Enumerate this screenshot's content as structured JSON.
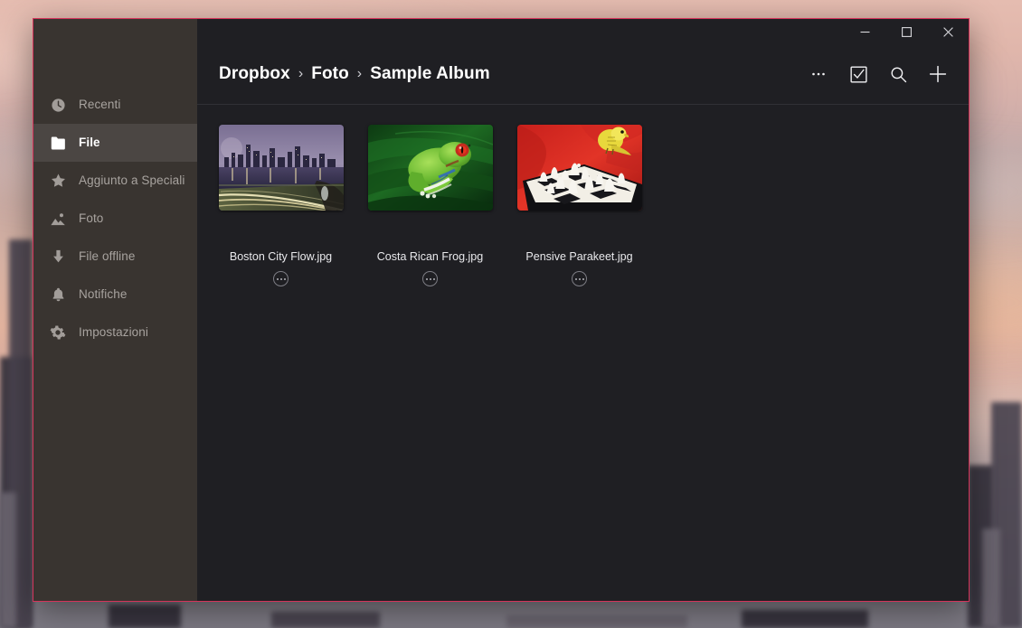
{
  "window": {
    "accent_border_color": "#d4335a",
    "sidebar_bg": "#393430",
    "content_bg": "#1f1f23",
    "controls": {
      "minimize": "minimize",
      "maximize": "maximize",
      "close": "close"
    }
  },
  "sidebar": {
    "items": [
      {
        "label": "Recenti",
        "icon": "clock-icon",
        "selected": false
      },
      {
        "label": "File",
        "icon": "folder-icon",
        "selected": true
      },
      {
        "label": "Aggiunto a Speciali",
        "icon": "star-icon",
        "selected": false
      },
      {
        "label": "Foto",
        "icon": "photo-icon",
        "selected": false
      },
      {
        "label": "File offline",
        "icon": "download-arrow-icon",
        "selected": false
      },
      {
        "label": "Notifiche",
        "icon": "bell-icon",
        "selected": false
      },
      {
        "label": "Impostazioni",
        "icon": "gear-icon",
        "selected": false
      }
    ]
  },
  "header": {
    "breadcrumb": [
      {
        "label": "Dropbox"
      },
      {
        "label": "Foto"
      },
      {
        "label": "Sample Album"
      }
    ],
    "separator": "›",
    "toolbar": [
      {
        "name": "more-options-button",
        "icon": "ellipsis-icon",
        "label": "..."
      },
      {
        "name": "select-button",
        "icon": "checkbox-check-icon",
        "label": "Seleziona"
      },
      {
        "name": "search-button",
        "icon": "search-icon",
        "label": "Cerca"
      },
      {
        "name": "add-button",
        "icon": "plus-icon",
        "label": "Aggiungi"
      }
    ]
  },
  "main": {
    "files": [
      {
        "name": "Boston City Flow.jpg",
        "thumbnail": "boston-city-night-skyline"
      },
      {
        "name": "Costa Rican Frog.jpg",
        "thumbnail": "green-tree-frog-on-leaf"
      },
      {
        "name": "Pensive Parakeet.jpg",
        "thumbnail": "parakeet-on-chessboard"
      }
    ],
    "more_label": "···"
  }
}
